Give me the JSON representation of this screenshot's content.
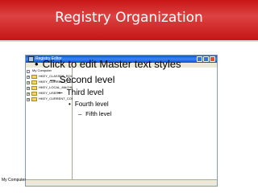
{
  "slide": {
    "title": "Registry Organization",
    "accent_color": "#d02020"
  },
  "regedit": {
    "title": "Registry Editor",
    "status_text": "My Computer",
    "tree": [
      {
        "label": "My Computer"
      },
      {
        "label": "HKEY_CLASSES_ROOT"
      },
      {
        "label": "HKEY_CURRENT_USER"
      },
      {
        "label": "HKEY_LOCAL_MACHINE"
      },
      {
        "label": "HKEY_USERS"
      },
      {
        "label": "HKEY_CURRENT_CONFIG"
      }
    ]
  },
  "placeholder": {
    "level1": "Click to edit Master text styles",
    "level2": "Second level",
    "level3": "Third level",
    "level4": "Fourth level",
    "level5": "Fifth level"
  }
}
